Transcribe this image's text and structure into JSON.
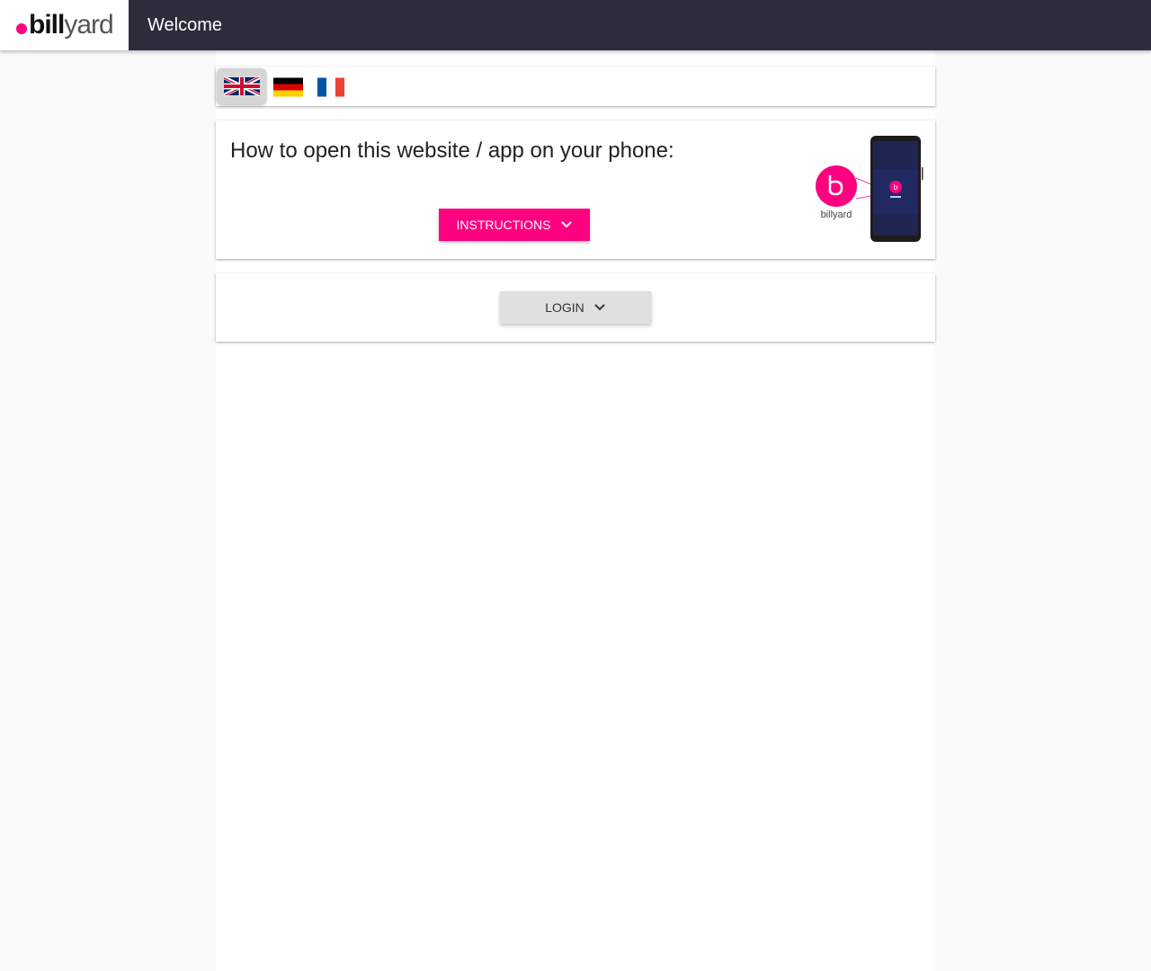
{
  "header": {
    "logo_part1": "bill",
    "logo_part2": "yard",
    "title": "Welcome"
  },
  "languages": [
    {
      "code": "en",
      "icon": "uk-flag-icon",
      "selected": true
    },
    {
      "code": "de",
      "icon": "german-flag-icon",
      "selected": false
    },
    {
      "code": "fr",
      "icon": "french-flag-icon",
      "selected": false
    }
  ],
  "instructions_card": {
    "heading": "How to open this website / app on your phone:",
    "button_label": "INSTRUCTIONS",
    "illustration_label": "billyard",
    "app_icon_letter": "b"
  },
  "login_card": {
    "button_label": "LOGIN"
  },
  "colors": {
    "accent": "#ff0080",
    "topbar": "#2b2d3a",
    "background": "#fafafa"
  }
}
